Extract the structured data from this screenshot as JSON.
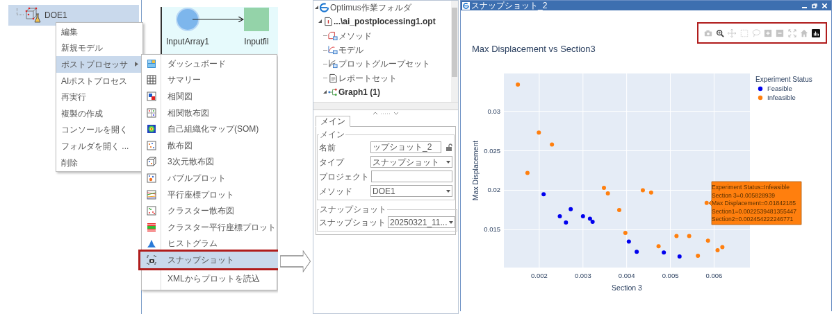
{
  "workspace": {
    "tree_item": {
      "label": "DOE1",
      "selected": true
    },
    "canvas_nodes": [
      {
        "label": "InputArray1",
        "kind": "circle"
      },
      {
        "label": "Inputfil",
        "kind": "square"
      }
    ]
  },
  "context_menu": {
    "items": [
      {
        "label": "編集",
        "selected": false,
        "submenu": false
      },
      {
        "label": "新規モデル",
        "selected": false,
        "submenu": false
      },
      {
        "label": "ポストプロセッサ",
        "selected": true,
        "submenu": true
      },
      {
        "label": "AIポストプロセス",
        "selected": false,
        "submenu": false
      },
      {
        "label": "再実行",
        "selected": false,
        "submenu": false
      },
      {
        "label": "複製の作成",
        "selected": false,
        "submenu": false
      },
      {
        "label": "コンソールを開く",
        "selected": false,
        "submenu": false
      },
      {
        "label": "フォルダを開く ...",
        "selected": false,
        "submenu": false
      },
      {
        "label": "削除",
        "selected": false,
        "submenu": false
      }
    ]
  },
  "submenu": {
    "items": [
      {
        "label": "ダッシュボード",
        "selected": false,
        "outlined": false
      },
      {
        "label": "サマリー",
        "selected": false,
        "outlined": false
      },
      {
        "label": "相関図",
        "selected": false,
        "outlined": false
      },
      {
        "label": "相関散布図",
        "selected": false,
        "outlined": false
      },
      {
        "label": "自己組織化マップ(SOM)",
        "selected": false,
        "outlined": false
      },
      {
        "label": "散布図",
        "selected": false,
        "outlined": false
      },
      {
        "label": "3次元散布図",
        "selected": false,
        "outlined": false
      },
      {
        "label": "バブルプロット",
        "selected": false,
        "outlined": false
      },
      {
        "label": "平行座標プロット",
        "selected": false,
        "outlined": false
      },
      {
        "label": "クラスター散布図",
        "selected": false,
        "outlined": false
      },
      {
        "label": "クラスター平行座標プロット",
        "selected": false,
        "outlined": false
      },
      {
        "label": "ヒストグラム",
        "selected": false,
        "outlined": false
      },
      {
        "label": "スナップショット",
        "selected": true,
        "outlined": true
      },
      {
        "label": "XMLからプロットを読込",
        "selected": false,
        "outlined": false
      }
    ]
  },
  "project_tree": {
    "items": [
      {
        "label": "Optimus作業フォルダ",
        "kind": "workspace",
        "bold": false,
        "expanded": true,
        "children": [
          {
            "label": "...\\ai_postplocessing1.opt",
            "kind": "project",
            "bold": true,
            "expanded": true,
            "children": [
              {
                "label": "メソッド",
                "kind": "method",
                "bold": false
              },
              {
                "label": "モデル",
                "kind": "model",
                "bold": false
              },
              {
                "label": "プロットグループセット",
                "kind": "plotgroup",
                "bold": false
              },
              {
                "label": "レポートセット",
                "kind": "report",
                "bold": false
              },
              {
                "label": "Graph1 (1)",
                "kind": "graph",
                "bold": true,
                "expanded": true
              }
            ]
          }
        ]
      }
    ]
  },
  "properties": {
    "tab": {
      "label": "メイン",
      "selected": true
    },
    "groups": [
      {
        "title": "メイン",
        "fields": [
          {
            "label": "名前",
            "kind": "text",
            "value": "ップショット_2",
            "lock": {
              "locked": false
            }
          },
          {
            "label": "タイプ",
            "kind": "select",
            "value": "スナップショット"
          },
          {
            "label": "プロジェクト",
            "kind": "text"
          },
          {
            "label": "メソッド",
            "kind": "select",
            "value": "DOE1"
          }
        ]
      },
      {
        "title": "スナップショット",
        "fields": [
          {
            "label": "スナップショット",
            "kind": "select",
            "value": "20250321_11..."
          }
        ]
      }
    ]
  },
  "window": {
    "title": "スナップショット_2",
    "plot_toolbar": {
      "outlined": true,
      "tools": [
        {
          "selected": false
        },
        {
          "selected": true
        },
        {
          "selected": false
        },
        {
          "selected": false
        },
        {
          "selected": false
        },
        {
          "selected": false
        },
        {
          "selected": false
        },
        {
          "selected": false
        },
        {
          "selected": false
        }
      ]
    },
    "chart_data": {
      "type": "scatter",
      "title": "Max Displacement vs Section3",
      "xlabel": "Section 3",
      "ylabel": "Max Displacement",
      "legend": {
        "title": "Experiment Status"
      },
      "series": [
        {
          "name": "Feasible",
          "color": "#0000ee",
          "x": [
            0.0021,
            0.00247,
            0.00261,
            0.00272,
            0.003,
            0.00316,
            0.00322,
            0.00405,
            0.00423,
            0.00485,
            0.00521
          ],
          "values": [
            0.0195,
            0.0167,
            0.0159,
            0.0176,
            0.0167,
            0.0164,
            0.016,
            0.0135,
            0.0122,
            0.0121,
            0.0116
          ]
        },
        {
          "name": "Infeasible",
          "color": "#ff7f0e",
          "x": [
            0.00151,
            0.00173,
            0.00199,
            0.00229,
            0.00348,
            0.00357,
            0.00383,
            0.00397,
            0.00437,
            0.00456,
            0.00473,
            0.00514,
            0.00543,
            0.00563,
            0.00583,
            0.00586,
            0.00608,
            0.00619
          ],
          "values": [
            0.0334,
            0.0222,
            0.0273,
            0.0258,
            0.0203,
            0.0196,
            0.0175,
            0.0146,
            0.02,
            0.0197,
            0.0129,
            0.0142,
            0.0142,
            0.0117,
            0.0184,
            0.0136,
            0.0124,
            0.0128
          ]
        }
      ],
      "grid": true,
      "xlim": [
        0.00119,
        0.00682
      ],
      "ylim": [
        0.0102,
        0.0348
      ],
      "xticks": [
        0.002,
        0.003,
        0.004,
        0.005,
        0.006
      ],
      "yticks": [
        0.015,
        0.02,
        0.025,
        0.03
      ],
      "annotations": [
        {
          "text": [
            "Experiment Status=Infeasible",
            "Section 3=0.005828939",
            "Max Displacement=0.01842185",
            "Section1=0.0022539481355447",
            "Section2=0.002454222246771"
          ]
        }
      ]
    }
  }
}
